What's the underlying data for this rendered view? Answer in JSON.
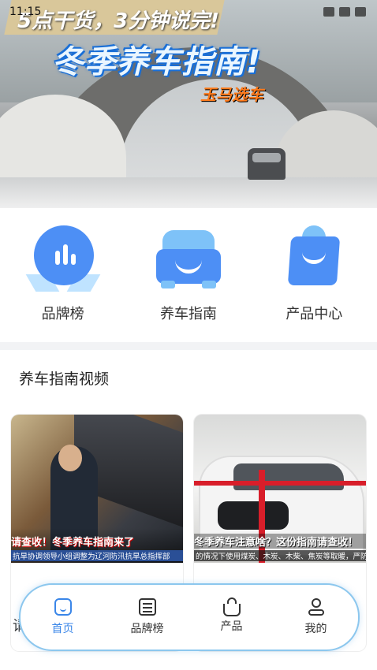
{
  "status_bar": {
    "time": "11:15"
  },
  "banner": {
    "headline_small": "5点干货，3分钟说完!",
    "headline_big": "冬季养车指南!",
    "logo_text": "玉马选车"
  },
  "categories": [
    {
      "label": "品牌榜",
      "icon": "medal-chart-icon"
    },
    {
      "label": "养车指南",
      "icon": "car-smile-icon"
    },
    {
      "label": "产品中心",
      "icon": "shopping-bag-icon"
    }
  ],
  "section": {
    "title": "养车指南视频",
    "videos": [
      {
        "caption": "请查收！冬季养车指南来了",
        "subcaption": "抗旱协调领导小组调整为辽河防汛抗旱总指挥部"
      },
      {
        "caption": "冬季养车注意啥？这份指南请查收！",
        "subcaption": "的情况下使用煤炭、木炭、木柴、焦炭等取暖，严防一氧化碳"
      }
    ],
    "behind_text": "请"
  },
  "bottom_nav": [
    {
      "label": "首页",
      "icon": "home-icon",
      "active": true
    },
    {
      "label": "品牌榜",
      "icon": "list-icon",
      "active": false
    },
    {
      "label": "产品",
      "icon": "basket-icon",
      "active": false
    },
    {
      "label": "我的",
      "icon": "user-icon",
      "active": false
    }
  ],
  "colors": {
    "accent": "#3a86e8",
    "icon_blue": "#4d8ff5",
    "icon_light": "#7ec2f8"
  }
}
